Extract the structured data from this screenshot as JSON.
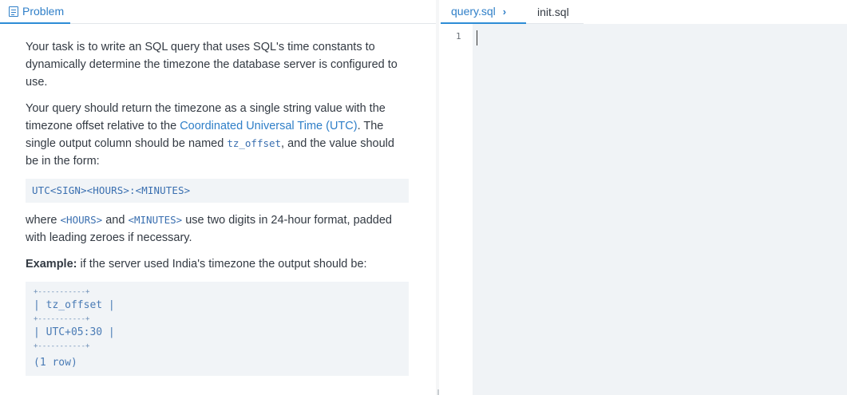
{
  "left_panel": {
    "tab_label": "Problem",
    "p1": "Your task is to write an SQL query that uses SQL's time constants to dynamically determine the timezone the database server is configured to use.",
    "p2_a": "Your query should return the timezone as a single string value with the timezone offset relative to the ",
    "p2_link": "Coordinated Universal Time (UTC)",
    "p2_b": ". The single output column should be named ",
    "p2_code": "tz_offset",
    "p2_c": ", and the value should be in the form:",
    "format_code": "UTC<SIGN><HOURS>:<MINUTES>",
    "p3_a": "where ",
    "p3_code1": "<HOURS>",
    "p3_b": " and ",
    "p3_code2": "<MINUTES>",
    "p3_c": " use two digits in 24-hour format, padded with leading zeroes if necessary.",
    "example_label": "Example:",
    "example_text": " if the server used India's timezone the output should be:",
    "table_sep": "+-----------+",
    "table_header": "| tz_offset |",
    "table_value": "| UTC+05:30 |",
    "table_footer": "(1 row)"
  },
  "editor": {
    "tabs": [
      {
        "label": "query.sql"
      },
      {
        "label": "init.sql"
      }
    ],
    "line_number": "1"
  },
  "colors": {
    "accent": "#2f7fc8",
    "editor_bg": "#f0f3f6",
    "code_bg": "#f1f4f7"
  }
}
